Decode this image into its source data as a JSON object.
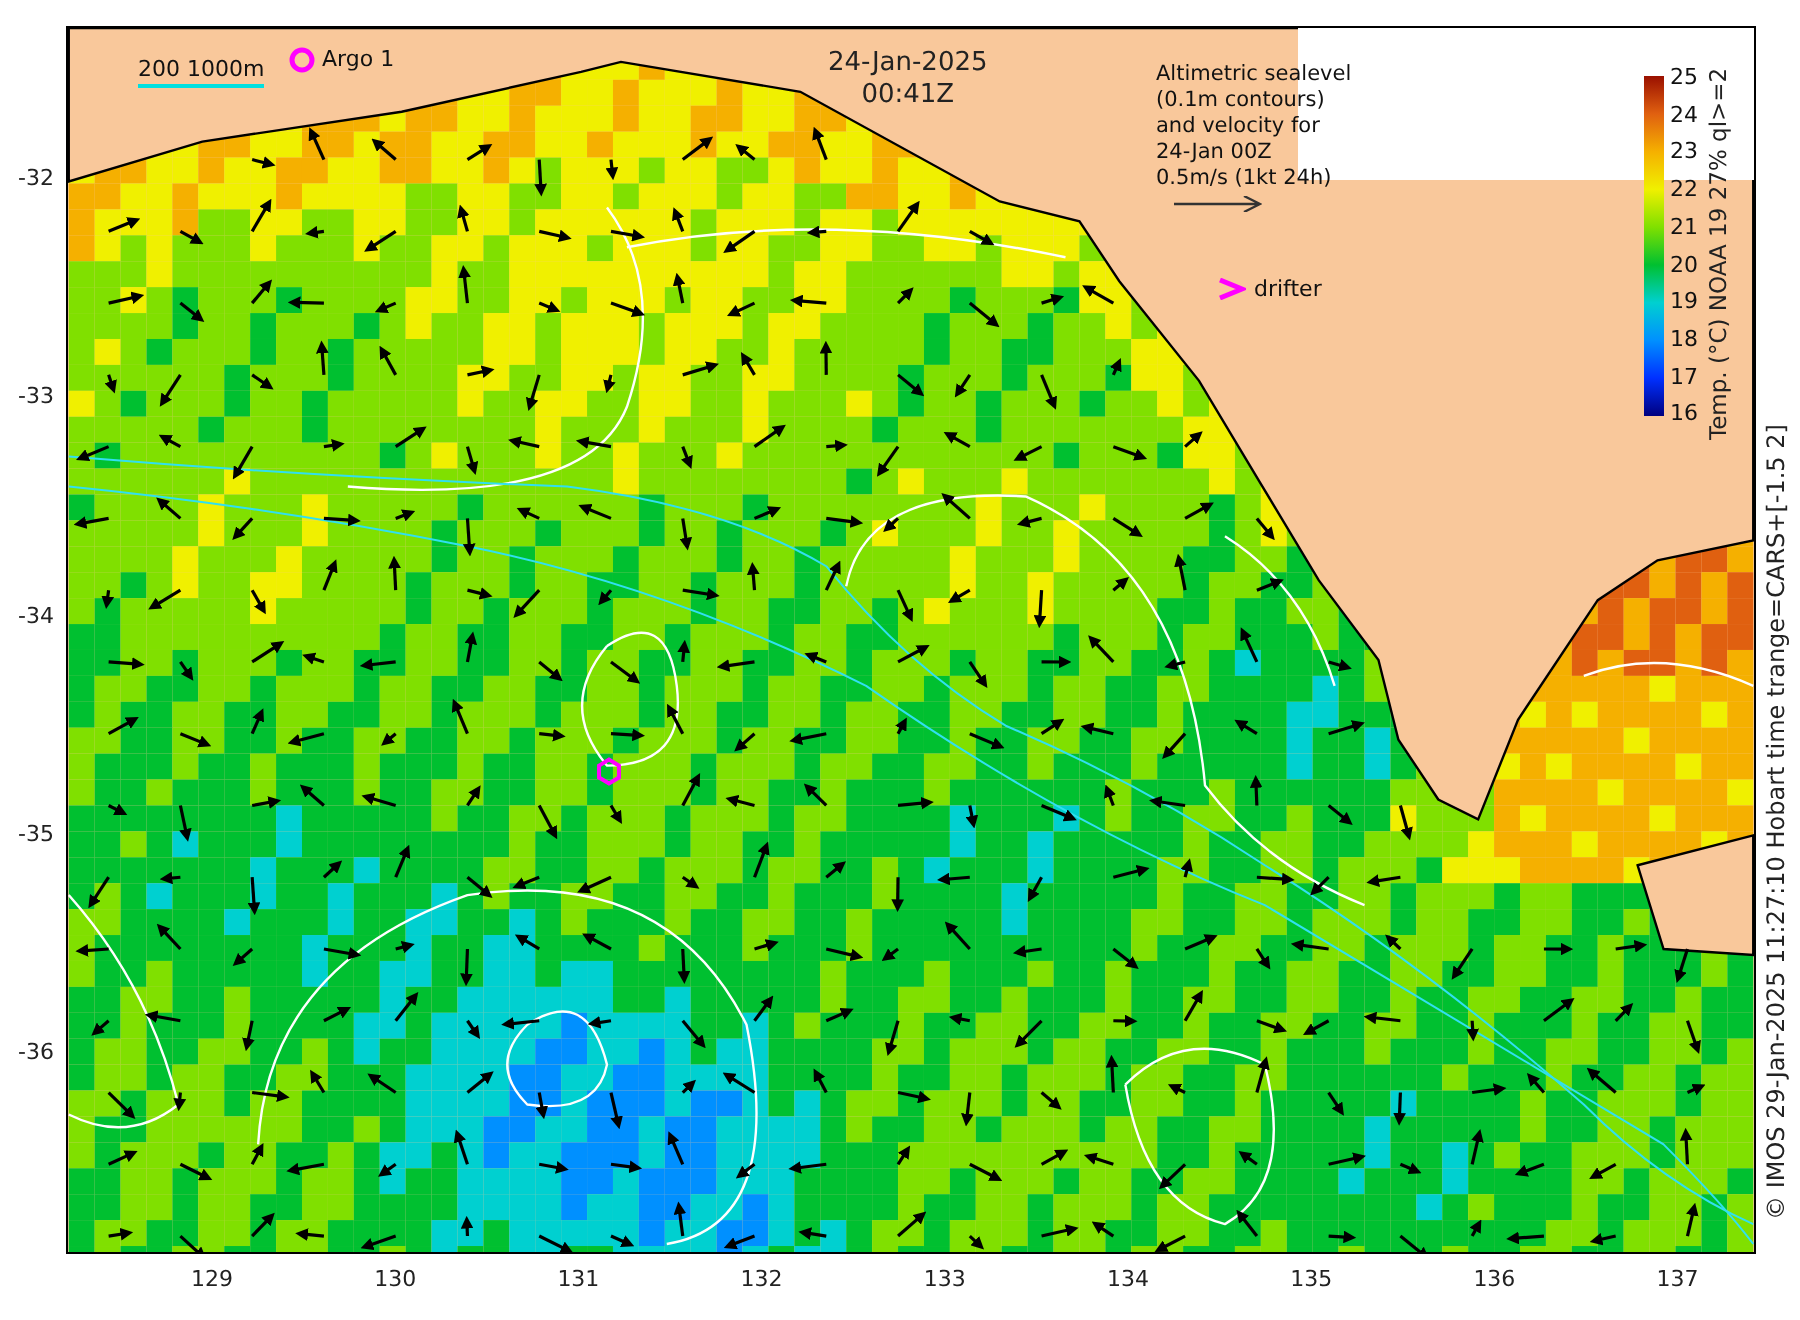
{
  "map": {
    "date": "24-Jan-2025",
    "time": "00:41Z"
  },
  "legend": {
    "isobaths": "200  1000m",
    "argo": "Argo 1",
    "altimetry": [
      "Altimetric sealevel",
      "(0.1m contours)",
      "and velocity for",
      "24-Jan 00Z",
      "0.5m/s (1kt 24h)"
    ],
    "drifter": "drifter"
  },
  "colorbar": {
    "label": "Temp. (°C) NOAA 19 27% ql>=2",
    "ticks": [
      "25",
      "24",
      "23",
      "22",
      "21",
      "20",
      "19",
      "18",
      "17",
      "16"
    ]
  },
  "x_axis": {
    "ticks": [
      "129",
      "130",
      "131",
      "132",
      "133",
      "134",
      "135",
      "136",
      "137"
    ]
  },
  "y_axis": {
    "ticks": [
      "-32",
      "-33",
      "-34",
      "-35",
      "-36"
    ]
  },
  "caption": "© IMOS 29-Jan-2025 11:27:10 Hobart time trange=CARS+[-1.5 2]"
}
